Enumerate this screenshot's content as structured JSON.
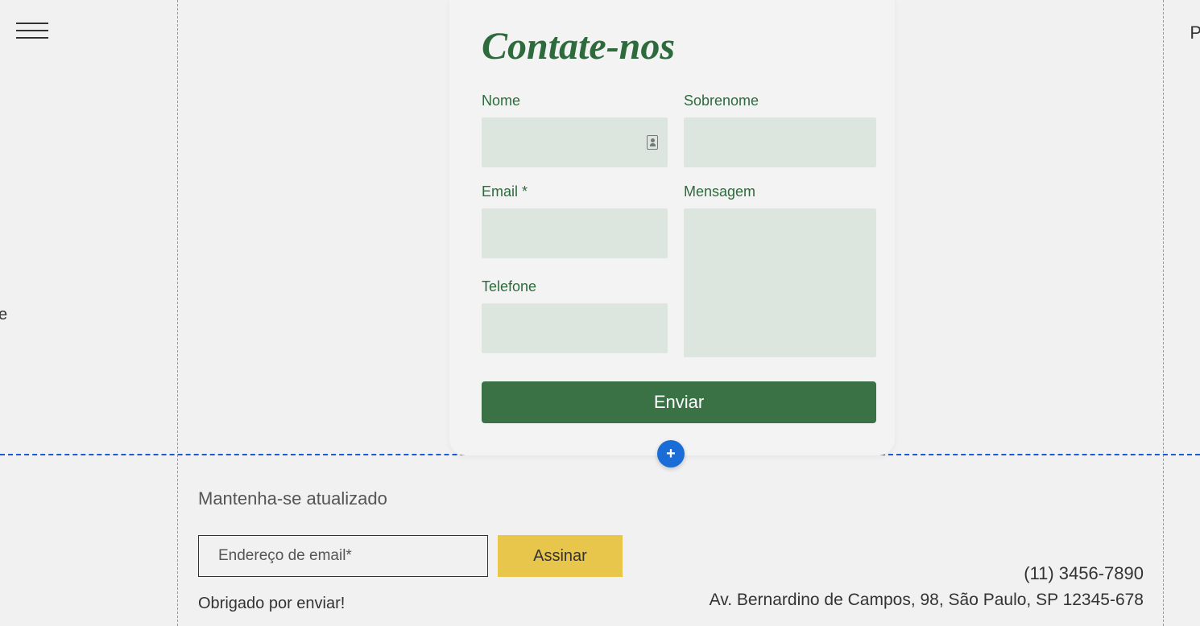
{
  "edge": {
    "left": "e",
    "right": "P"
  },
  "contact": {
    "title": "Contate-nos",
    "fields": {
      "nome": "Nome",
      "sobrenome": "Sobrenome",
      "email": "Email *",
      "telefone": "Telefone",
      "mensagem": "Mensagem"
    },
    "submit": "Enviar"
  },
  "addBtn": "+",
  "footer": {
    "title": "Mantenha-se atualizado",
    "emailPlaceholder": "Endereço de email*",
    "subscribe": "Assinar",
    "thanks": "Obrigado por enviar!"
  },
  "info": {
    "phone": "(11) 3456-7890",
    "address": "Av. Bernardino de Campos, 98, São Paulo, SP 12345-678"
  }
}
